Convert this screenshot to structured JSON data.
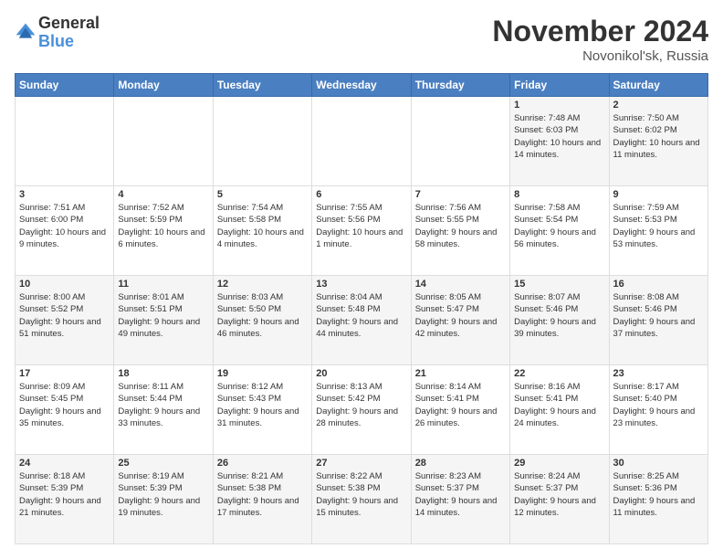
{
  "logo": {
    "general": "General",
    "blue": "Blue"
  },
  "title": "November 2024",
  "location": "Novonikol'sk, Russia",
  "days_of_week": [
    "Sunday",
    "Monday",
    "Tuesday",
    "Wednesday",
    "Thursday",
    "Friday",
    "Saturday"
  ],
  "weeks": [
    [
      {
        "day": "",
        "info": ""
      },
      {
        "day": "",
        "info": ""
      },
      {
        "day": "",
        "info": ""
      },
      {
        "day": "",
        "info": ""
      },
      {
        "day": "",
        "info": ""
      },
      {
        "day": "1",
        "info": "Sunrise: 7:48 AM\nSunset: 6:03 PM\nDaylight: 10 hours and 14 minutes."
      },
      {
        "day": "2",
        "info": "Sunrise: 7:50 AM\nSunset: 6:02 PM\nDaylight: 10 hours and 11 minutes."
      }
    ],
    [
      {
        "day": "3",
        "info": "Sunrise: 7:51 AM\nSunset: 6:00 PM\nDaylight: 10 hours and 9 minutes."
      },
      {
        "day": "4",
        "info": "Sunrise: 7:52 AM\nSunset: 5:59 PM\nDaylight: 10 hours and 6 minutes."
      },
      {
        "day": "5",
        "info": "Sunrise: 7:54 AM\nSunset: 5:58 PM\nDaylight: 10 hours and 4 minutes."
      },
      {
        "day": "6",
        "info": "Sunrise: 7:55 AM\nSunset: 5:56 PM\nDaylight: 10 hours and 1 minute."
      },
      {
        "day": "7",
        "info": "Sunrise: 7:56 AM\nSunset: 5:55 PM\nDaylight: 9 hours and 58 minutes."
      },
      {
        "day": "8",
        "info": "Sunrise: 7:58 AM\nSunset: 5:54 PM\nDaylight: 9 hours and 56 minutes."
      },
      {
        "day": "9",
        "info": "Sunrise: 7:59 AM\nSunset: 5:53 PM\nDaylight: 9 hours and 53 minutes."
      }
    ],
    [
      {
        "day": "10",
        "info": "Sunrise: 8:00 AM\nSunset: 5:52 PM\nDaylight: 9 hours and 51 minutes."
      },
      {
        "day": "11",
        "info": "Sunrise: 8:01 AM\nSunset: 5:51 PM\nDaylight: 9 hours and 49 minutes."
      },
      {
        "day": "12",
        "info": "Sunrise: 8:03 AM\nSunset: 5:50 PM\nDaylight: 9 hours and 46 minutes."
      },
      {
        "day": "13",
        "info": "Sunrise: 8:04 AM\nSunset: 5:48 PM\nDaylight: 9 hours and 44 minutes."
      },
      {
        "day": "14",
        "info": "Sunrise: 8:05 AM\nSunset: 5:47 PM\nDaylight: 9 hours and 42 minutes."
      },
      {
        "day": "15",
        "info": "Sunrise: 8:07 AM\nSunset: 5:46 PM\nDaylight: 9 hours and 39 minutes."
      },
      {
        "day": "16",
        "info": "Sunrise: 8:08 AM\nSunset: 5:46 PM\nDaylight: 9 hours and 37 minutes."
      }
    ],
    [
      {
        "day": "17",
        "info": "Sunrise: 8:09 AM\nSunset: 5:45 PM\nDaylight: 9 hours and 35 minutes."
      },
      {
        "day": "18",
        "info": "Sunrise: 8:11 AM\nSunset: 5:44 PM\nDaylight: 9 hours and 33 minutes."
      },
      {
        "day": "19",
        "info": "Sunrise: 8:12 AM\nSunset: 5:43 PM\nDaylight: 9 hours and 31 minutes."
      },
      {
        "day": "20",
        "info": "Sunrise: 8:13 AM\nSunset: 5:42 PM\nDaylight: 9 hours and 28 minutes."
      },
      {
        "day": "21",
        "info": "Sunrise: 8:14 AM\nSunset: 5:41 PM\nDaylight: 9 hours and 26 minutes."
      },
      {
        "day": "22",
        "info": "Sunrise: 8:16 AM\nSunset: 5:41 PM\nDaylight: 9 hours and 24 minutes."
      },
      {
        "day": "23",
        "info": "Sunrise: 8:17 AM\nSunset: 5:40 PM\nDaylight: 9 hours and 23 minutes."
      }
    ],
    [
      {
        "day": "24",
        "info": "Sunrise: 8:18 AM\nSunset: 5:39 PM\nDaylight: 9 hours and 21 minutes."
      },
      {
        "day": "25",
        "info": "Sunrise: 8:19 AM\nSunset: 5:39 PM\nDaylight: 9 hours and 19 minutes."
      },
      {
        "day": "26",
        "info": "Sunrise: 8:21 AM\nSunset: 5:38 PM\nDaylight: 9 hours and 17 minutes."
      },
      {
        "day": "27",
        "info": "Sunrise: 8:22 AM\nSunset: 5:38 PM\nDaylight: 9 hours and 15 minutes."
      },
      {
        "day": "28",
        "info": "Sunrise: 8:23 AM\nSunset: 5:37 PM\nDaylight: 9 hours and 14 minutes."
      },
      {
        "day": "29",
        "info": "Sunrise: 8:24 AM\nSunset: 5:37 PM\nDaylight: 9 hours and 12 minutes."
      },
      {
        "day": "30",
        "info": "Sunrise: 8:25 AM\nSunset: 5:36 PM\nDaylight: 9 hours and 11 minutes."
      }
    ]
  ]
}
